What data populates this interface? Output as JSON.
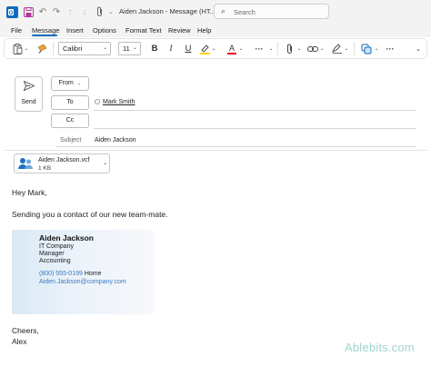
{
  "window": {
    "title": "Aiden Jackson  -  Message (HT...",
    "search_placeholder": "Search"
  },
  "menu": {
    "items": [
      "File",
      "Message",
      "Insert",
      "Options",
      "Format Text",
      "Review",
      "Help"
    ],
    "active": "Message"
  },
  "ribbon": {
    "font_name": "Calibri",
    "font_size": "11",
    "bold": "B",
    "italic": "I",
    "underline": "U",
    "font_color_glyph": "A",
    "more": "···"
  },
  "compose": {
    "send_label": "Send",
    "from_label": "From",
    "to_label": "To",
    "cc_label": "Cc",
    "to_recipient": "Mark Smith",
    "subject_label": "Subject",
    "subject_value": "Aiden Jackson"
  },
  "attachment": {
    "filename": "Aiden Jackson.vcf",
    "size": "1 KB"
  },
  "body": {
    "greeting": "Hey Mark,",
    "message": "Sending you a contact of our new team-mate.",
    "closing": "Cheers,",
    "signature": "Alex"
  },
  "card": {
    "name": "Aiden Jackson",
    "company": "IT Company",
    "title": "Manager",
    "department": "Accounting",
    "phone": "(800) 555-0199",
    "phone_label": "Home",
    "email": "Aiden.Jackson@company.com"
  },
  "watermark": "Ablebits.com",
  "colors": {
    "accent": "#0f6cbd",
    "link": "#3a7ac1",
    "watermark": "#9fd4cf",
    "highlight": "#ffd700",
    "font_color": "#e81123"
  }
}
